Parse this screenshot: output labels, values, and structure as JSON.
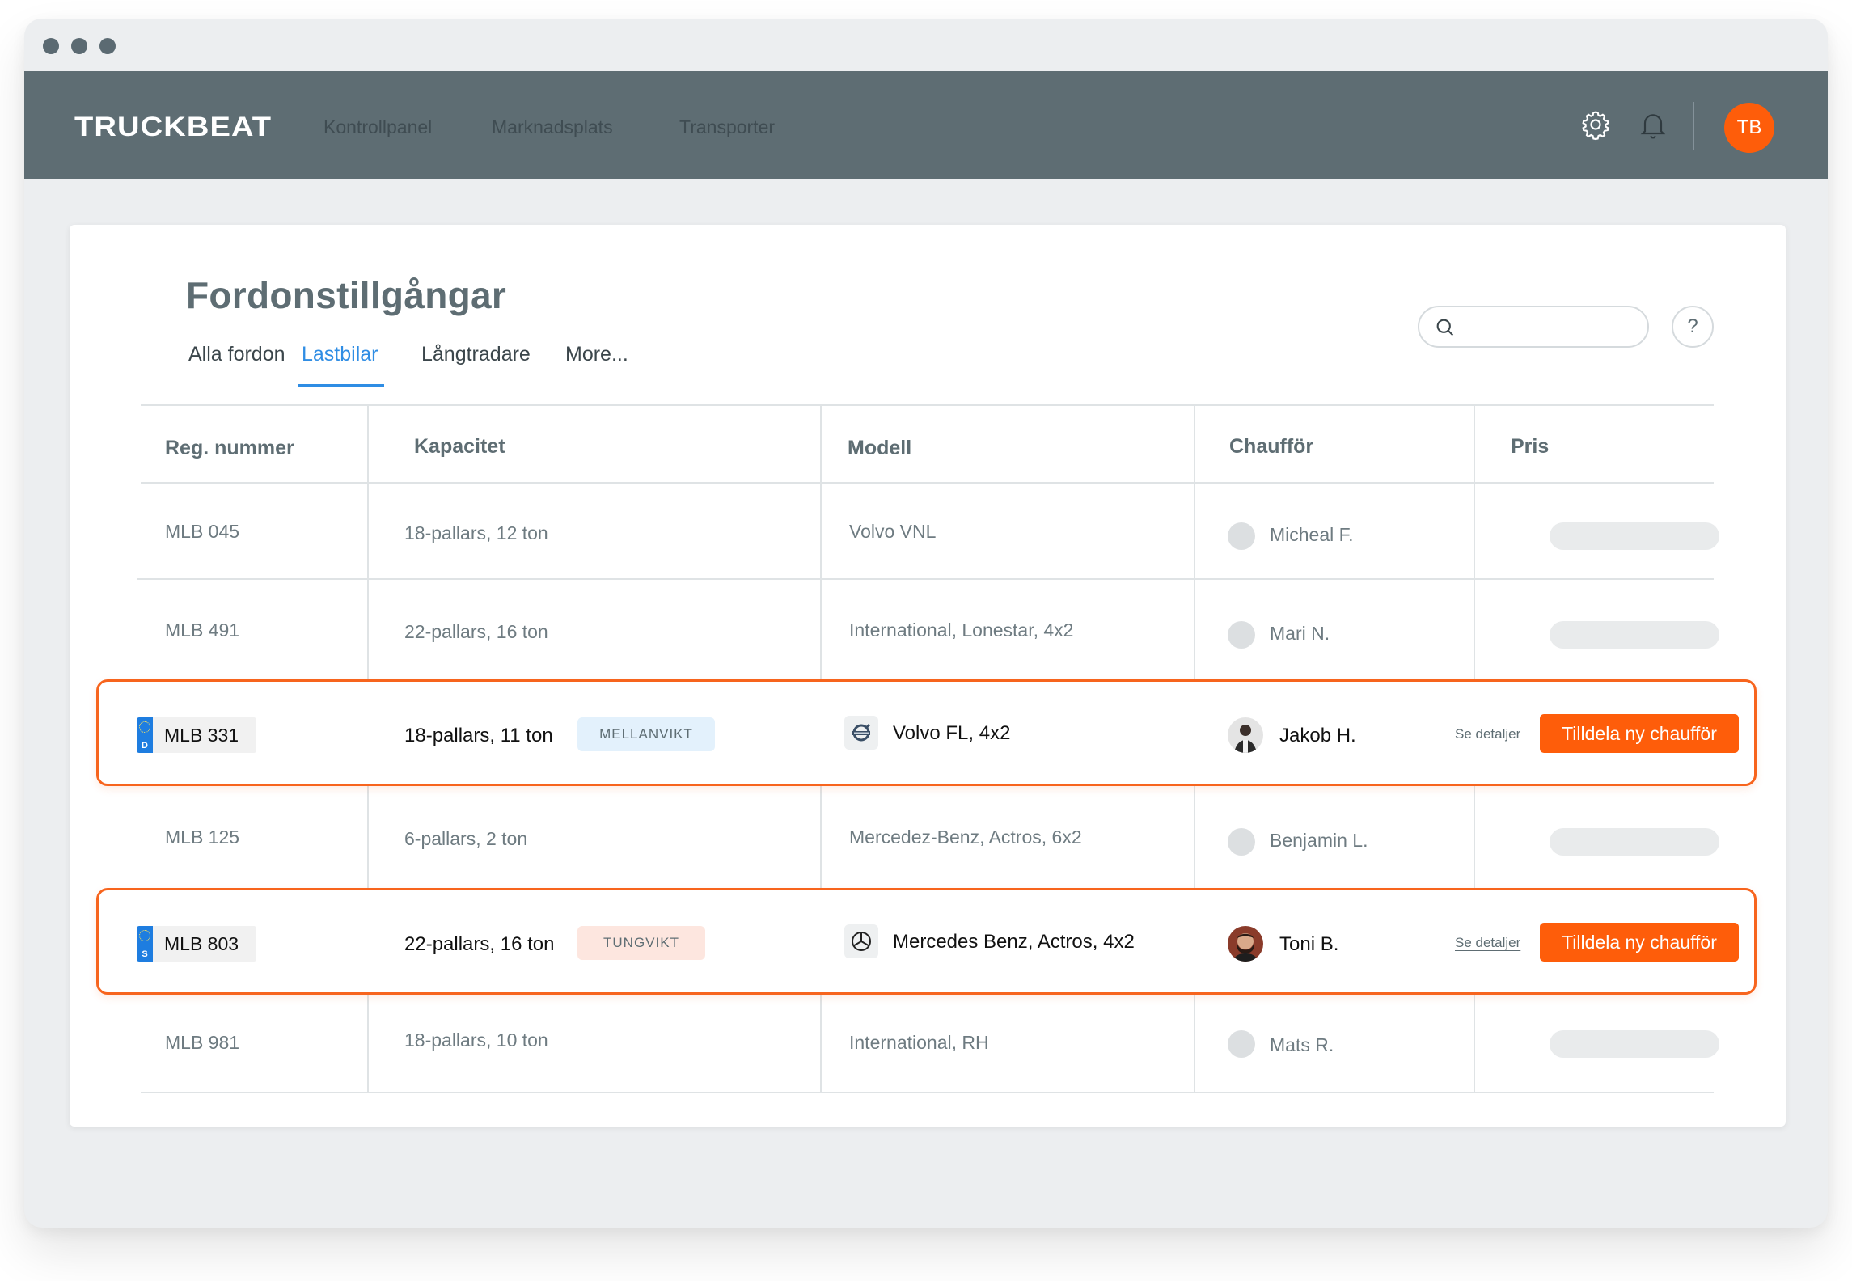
{
  "app": {
    "brand": "TRUCKBEAT",
    "user_initials": "TB"
  },
  "nav": {
    "links": [
      "Kontrollpanel",
      "Marknadsplats",
      "Transporter"
    ]
  },
  "colors": {
    "accent": "#fe5d0a",
    "nav_bg": "#5e6d73",
    "tab_active": "#2f8de4"
  },
  "page": {
    "title": "Fordonstillgångar",
    "tabs": [
      "Alla fordon",
      "Lastbilar",
      "Långtradare",
      "More..."
    ],
    "active_tab": "Lastbilar",
    "search": {
      "placeholder": ""
    },
    "help_label": "?"
  },
  "table": {
    "headers": [
      "Reg. nummer",
      "Kapacitet",
      "Modell",
      "Chaufför",
      "Pris"
    ],
    "rows": [
      {
        "reg": "MLB 045",
        "capacity": "18-pallars, 12 ton",
        "model": "Volvo VNL",
        "driver": "Micheal F.",
        "highlighted": false
      },
      {
        "reg": "MLB 491",
        "capacity": "22-pallars, 16 ton",
        "model": "International, Lonestar, 4x2",
        "driver": "Mari N.",
        "highlighted": false
      },
      {
        "reg": "MLB 331",
        "plate_country": "D",
        "capacity": "18-pallars, 11 ton",
        "badge": "MELLANVIKT",
        "model": "Volvo FL, 4x2",
        "brand_icon": "volvo-logo-icon",
        "driver": "Jakob H.",
        "details_label": "Se detaljer",
        "action_label": "Tilldela ny chaufför",
        "highlighted": true
      },
      {
        "reg": "MLB 125",
        "capacity": "6-pallars, 2 ton",
        "model": "Mercedez-Benz, Actros, 6x2",
        "driver": "Benjamin L.",
        "highlighted": false
      },
      {
        "reg": "MLB 803",
        "plate_country": "S",
        "capacity": "22-pallars, 16 ton",
        "badge": "TUNGVIKT",
        "model": "Mercedes Benz, Actros, 4x2",
        "brand_icon": "mercedes-logo-icon",
        "driver": "Toni B.",
        "details_label": "Se detaljer",
        "action_label": "Tilldela ny chaufför",
        "highlighted": true
      },
      {
        "reg": "MLB 981",
        "capacity": "18-pallars, 10 ton",
        "model": "International, RH",
        "driver": "Mats R.",
        "highlighted": false
      }
    ]
  }
}
